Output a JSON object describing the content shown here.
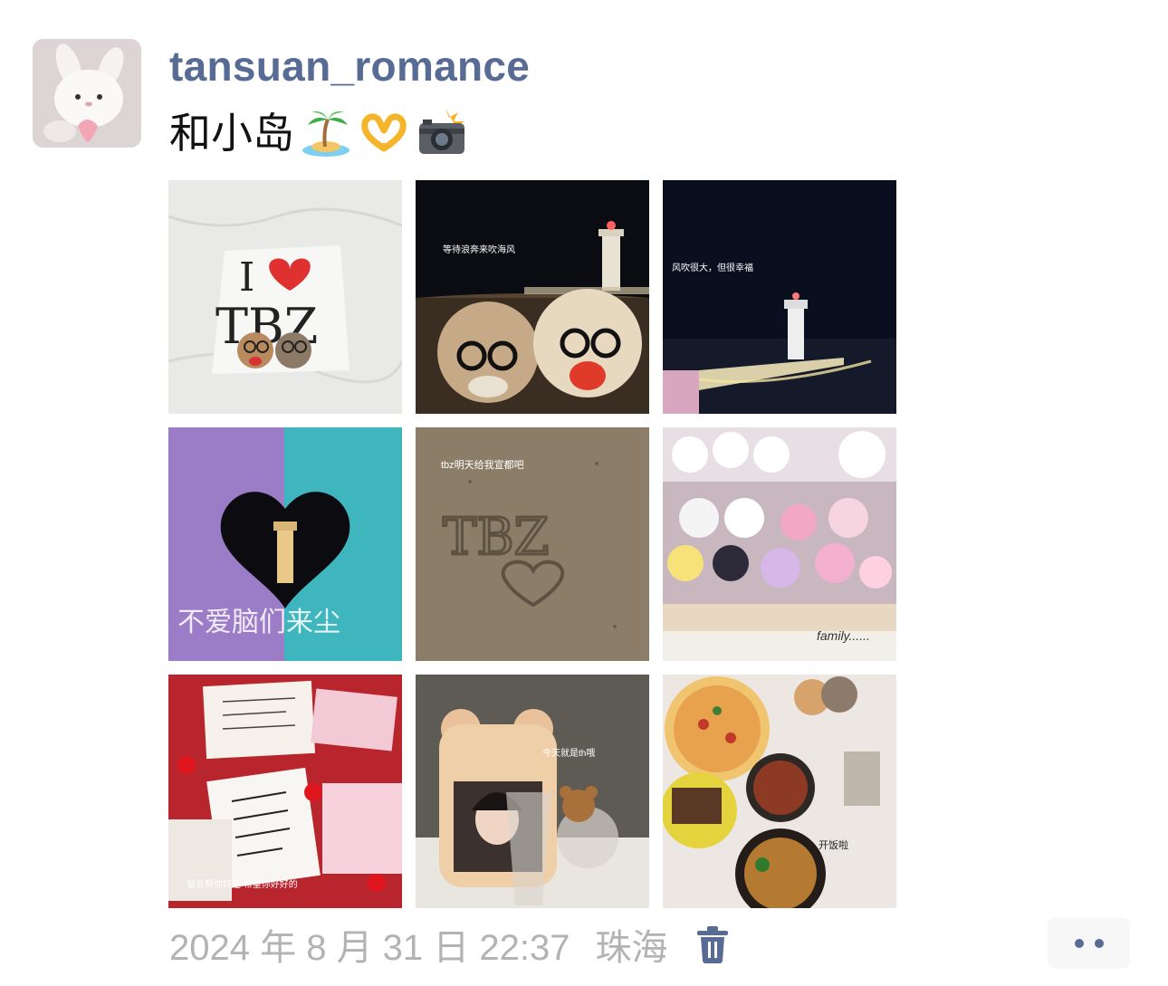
{
  "post": {
    "username": "tansuan_romance",
    "caption_text": "和小岛",
    "caption_emojis": [
      "palm-island-emoji",
      "heart-hands-emoji",
      "camera-flash-emoji"
    ],
    "photos": [
      {
        "overlay_text": ""
      },
      {
        "overlay_text": "等待浪奔来吹海风"
      },
      {
        "overlay_text": "风吹很大，但很幸福"
      },
      {
        "overlay_text": "不爱脑们来尘"
      },
      {
        "overlay_text": "tbz明天给我宣都吧"
      },
      {
        "overlay_text": "family......"
      },
      {
        "overlay_text": "留言帮你好运 希望你好好的"
      },
      {
        "overlay_text": "今天就是th哦"
      },
      {
        "overlay_text": "开饭啦"
      }
    ],
    "timestamp": "2024 年 8 月 31 日 22:37",
    "location": "珠海",
    "icons": {
      "delete": "trash-icon",
      "more": "more-dots-icon"
    }
  },
  "colors": {
    "username": "#576b95",
    "meta": "#b3b3b3",
    "more_bg": "#f7f7f7"
  }
}
